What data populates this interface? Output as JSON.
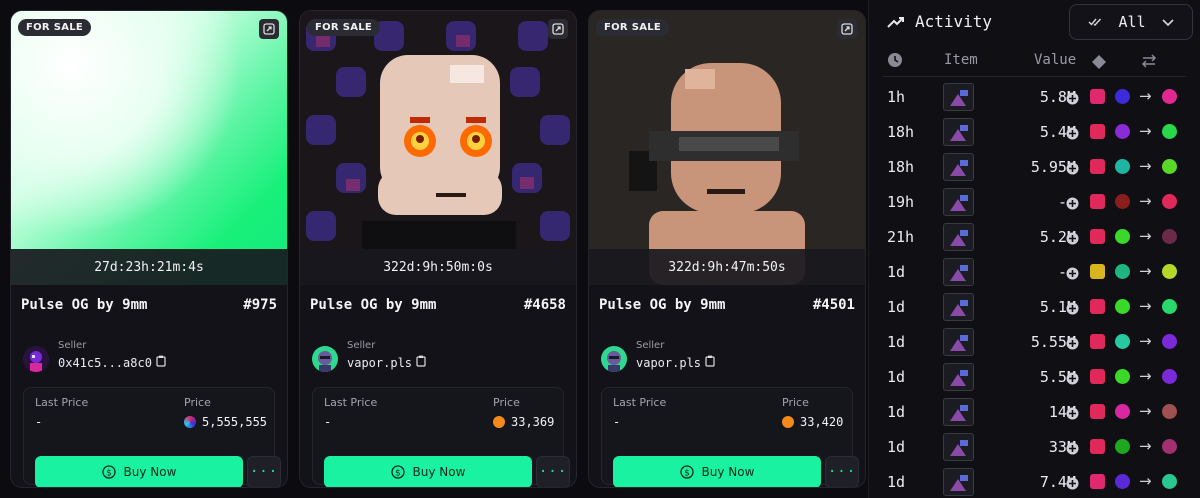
{
  "cards": [
    {
      "badge": "FOR SALE",
      "timer": "27d:23h:21m:4s",
      "title": "Pulse OG by 9mm",
      "number": "#975",
      "seller_label": "Seller",
      "seller_name": "0x41c5...a8c0",
      "last_price_label": "Last Price",
      "last_price_value": "-",
      "price_label": "Price",
      "price_value": "5,555,555",
      "buy_label": "Buy Now",
      "more_label": "···"
    },
    {
      "badge": "FOR SALE",
      "timer": "322d:9h:50m:0s",
      "title": "Pulse OG by 9mm",
      "number": "#4658",
      "seller_label": "Seller",
      "seller_name": "vapor.pls",
      "last_price_label": "Last Price",
      "last_price_value": "-",
      "price_label": "Price",
      "price_value": "33,369",
      "buy_label": "Buy Now",
      "more_label": "···"
    },
    {
      "badge": "FOR SALE",
      "timer": "322d:9h:47m:50s",
      "title": "Pulse OG by 9mm",
      "number": "#4501",
      "seller_label": "Seller",
      "seller_name": "vapor.pls",
      "last_price_label": "Last Price",
      "last_price_value": "-",
      "price_label": "Price",
      "price_value": "33,420",
      "buy_label": "Buy Now",
      "more_label": "···"
    }
  ],
  "activity": {
    "title": "Activity",
    "filter_label": "All",
    "columns": {
      "item": "Item",
      "value": "Value"
    },
    "rows": [
      {
        "time": "1h",
        "value": "5.8M",
        "c1": "#e0286e",
        "c2": "#3b2bd8",
        "c3": "#e02890"
      },
      {
        "time": "18h",
        "value": "5.4M",
        "c1": "#e0285a",
        "c2": "#8a2bd8",
        "c3": "#28d84a"
      },
      {
        "time": "18h",
        "value": "5.95M",
        "c1": "#e0285a",
        "c2": "#1fb5a0",
        "c3": "#5ad828"
      },
      {
        "time": "19h",
        "value": "--",
        "c1": "#e0285a",
        "c2": "#8a1e1e",
        "c3": "#e0285a"
      },
      {
        "time": "21h",
        "value": "5.2M",
        "c1": "#e0285a",
        "c2": "#3ad828",
        "c3": "#6a2a4a"
      },
      {
        "time": "1d",
        "value": "--",
        "c1": "#d8b41f",
        "c2": "#1fb580",
        "c3": "#b5d828"
      },
      {
        "time": "1d",
        "value": "5.1M",
        "c1": "#e0285a",
        "c2": "#3ad828",
        "c3": "#28d86a"
      },
      {
        "time": "1d",
        "value": "5.55M",
        "c1": "#e0285a",
        "c2": "#28c8a0",
        "c3": "#7a2ad8"
      },
      {
        "time": "1d",
        "value": "5.5M",
        "c1": "#e0285a",
        "c2": "#3ad828",
        "c3": "#7a2ad8"
      },
      {
        "time": "1d",
        "value": "14M",
        "c1": "#e0285a",
        "c2": "#d828a0",
        "c3": "#a05050"
      },
      {
        "time": "1d",
        "value": "33M",
        "c1": "#e0285a",
        "c2": "#1ea81e",
        "c3": "#a03070"
      },
      {
        "time": "1d",
        "value": "7.4M",
        "c1": "#e0286e",
        "c2": "#5a2ad8",
        "c3": "#28c890"
      }
    ]
  },
  "colors": {
    "accent": "#19f2a0",
    "bg": "#0b0b10",
    "card": "#121218"
  }
}
